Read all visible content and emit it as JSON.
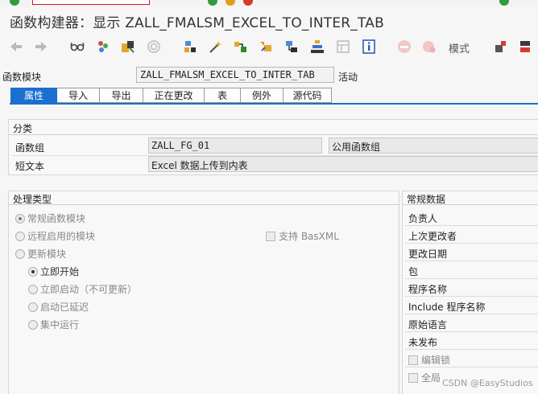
{
  "window": {
    "title": "函数构建器：显示 ZALL_FMALSM_EXCEL_TO_INTER_TAB"
  },
  "toolbar": {
    "icons": [
      "back-arrow-icon",
      "forward-arrow-icon",
      "glasses-icon",
      "other-object-icon",
      "where-used-icon",
      "display-object-list-icon",
      "wand-icon",
      "check-icon",
      "activate-icon",
      "test-icon",
      "hierarchy-icon",
      "pattern-icon",
      "info-icon",
      "stop-icon",
      "debug-icon"
    ],
    "mode_label": "模式"
  },
  "function_module": {
    "label": "函数模块",
    "value": "ZALL_FMALSM_EXCEL_TO_INTER_TAB",
    "status": "活动"
  },
  "tabs": [
    {
      "label": "属性",
      "active": true
    },
    {
      "label": "导入",
      "active": false
    },
    {
      "label": "导出",
      "active": false
    },
    {
      "label": "正在更改",
      "active": false
    },
    {
      "label": "表",
      "active": false
    },
    {
      "label": "例外",
      "active": false
    },
    {
      "label": "源代码",
      "active": false
    }
  ],
  "classification": {
    "title": "分类",
    "function_group_label": "函数组",
    "function_group_value": "ZALL_FG_01",
    "function_group_text": "公用函数组",
    "short_text_label": "短文本",
    "short_text_value": "Excel 数据上传到内表"
  },
  "processing_type": {
    "title": "处理类型",
    "normal": "常规函数模块",
    "remote": "远程启用的模块",
    "basxml": "支持 BasXML",
    "update": "更新模块",
    "immediate_start": "立即开始",
    "immediate_no_update": "立即启动（不可更新）",
    "start_delayed": "启动已延迟",
    "collective_run": "集中运行"
  },
  "general_data": {
    "title": "常规数据",
    "responsible": "负责人",
    "last_changed_by": "上次更改者",
    "changed_on": "更改日期",
    "package": "包",
    "program_name": "程序名称",
    "include_name": "Include 程序名称",
    "original_language": "原始语言",
    "not_released": "未发布",
    "edit_lock": "编辑锁",
    "global": "全局"
  },
  "watermark": "CSDN @EasyStudios",
  "colors": {
    "accent": "#1a6fcf",
    "field_bg": "#e9e9e9"
  }
}
